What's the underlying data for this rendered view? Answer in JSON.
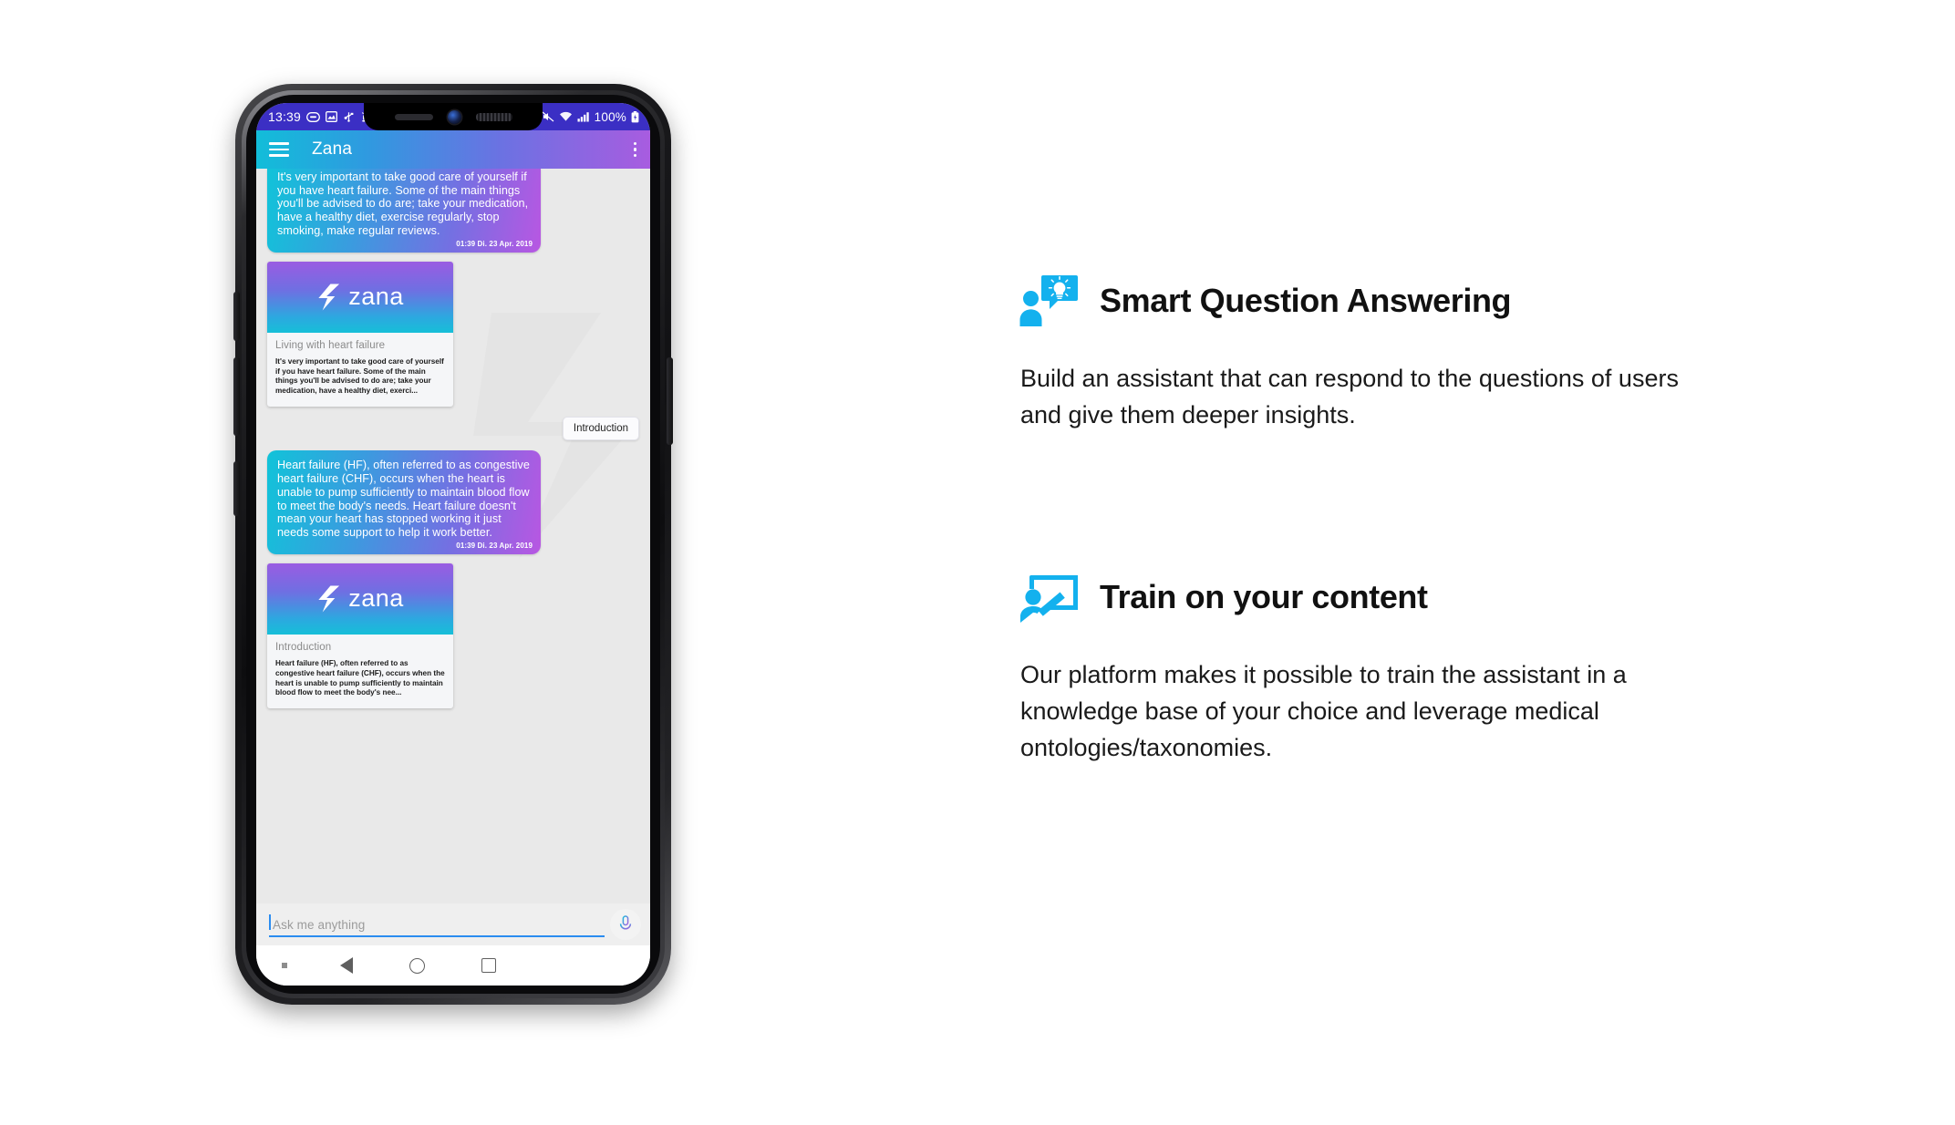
{
  "phone": {
    "status_bar": {
      "time": "13:39",
      "battery": "100%",
      "left_icons": [
        "sms-icon",
        "photo-icon",
        "usb-icon",
        "android-debug-icon"
      ],
      "right_icons": [
        "mute-icon",
        "wifi-icon",
        "signal-icon",
        "battery-icon"
      ]
    },
    "toolbar": {
      "menu_icon": "hamburger-menu-icon",
      "title": "Zana",
      "overflow_icon": "kebab-menu-icon",
      "gradient_from": "#12bdd9",
      "gradient_to": "#a85ce0"
    },
    "chat": {
      "messages": [
        {
          "type": "bot-bubble",
          "text": "It's very important to take good care of yourself if you have heart failure. Some of the main things you'll be advised to do are; take your medication, have a healthy diet, exercise regularly, stop smoking, make regular reviews.",
          "timestamp": "01:39 Di. 23 Apr. 2019"
        },
        {
          "type": "card",
          "brand": "zana",
          "title": "Living with heart failure",
          "text": "It's very important to take good care of yourself if you have heart failure. Some of the main things you'll be advised to do are; take your medication, have a healthy diet, exerci..."
        },
        {
          "type": "user-chip",
          "text": "Introduction"
        },
        {
          "type": "bot-bubble",
          "text": "Heart failure (HF), often referred to as congestive heart failure (CHF), occurs when the heart is unable to pump sufficiently to maintain blood flow to meet the body's needs. Heart failure doesn't mean your heart has stopped working it just needs some support to help it work better.",
          "timestamp": "01:39 Di. 23 Apr. 2019"
        },
        {
          "type": "card",
          "brand": "zana",
          "title": "Introduction",
          "text": "Heart failure (HF), often referred to as congestive heart failure (CHF), occurs when the heart is unable to pump sufficiently to maintain blood flow to meet the body's nee..."
        }
      ]
    },
    "input_bar": {
      "placeholder": "Ask me anything",
      "value": "",
      "mic_icon": "microphone-icon",
      "accent_color": "#2b8cf0"
    },
    "nav_bar": {
      "icons": [
        "dot-indicator-icon",
        "back-triangle-icon",
        "home-circle-icon",
        "recents-square-icon"
      ]
    }
  },
  "features": [
    {
      "icon": "person-lightbulb-idea-icon",
      "title": "Smart Question Answering",
      "body": "Build an assistant that can respond to the questions of users and give them deeper insights."
    },
    {
      "icon": "person-whiteboard-training-icon",
      "title": "Train on your content",
      "body": "Our platform makes it possible to train the assistant in a knowledge base of your choice and leverage medical ontologies/taxonomies."
    }
  ],
  "colors": {
    "icon_blue": "#13b1ee",
    "status_bar_blue": "#3b2fc4",
    "chat_bg": "#e9e9e9"
  }
}
